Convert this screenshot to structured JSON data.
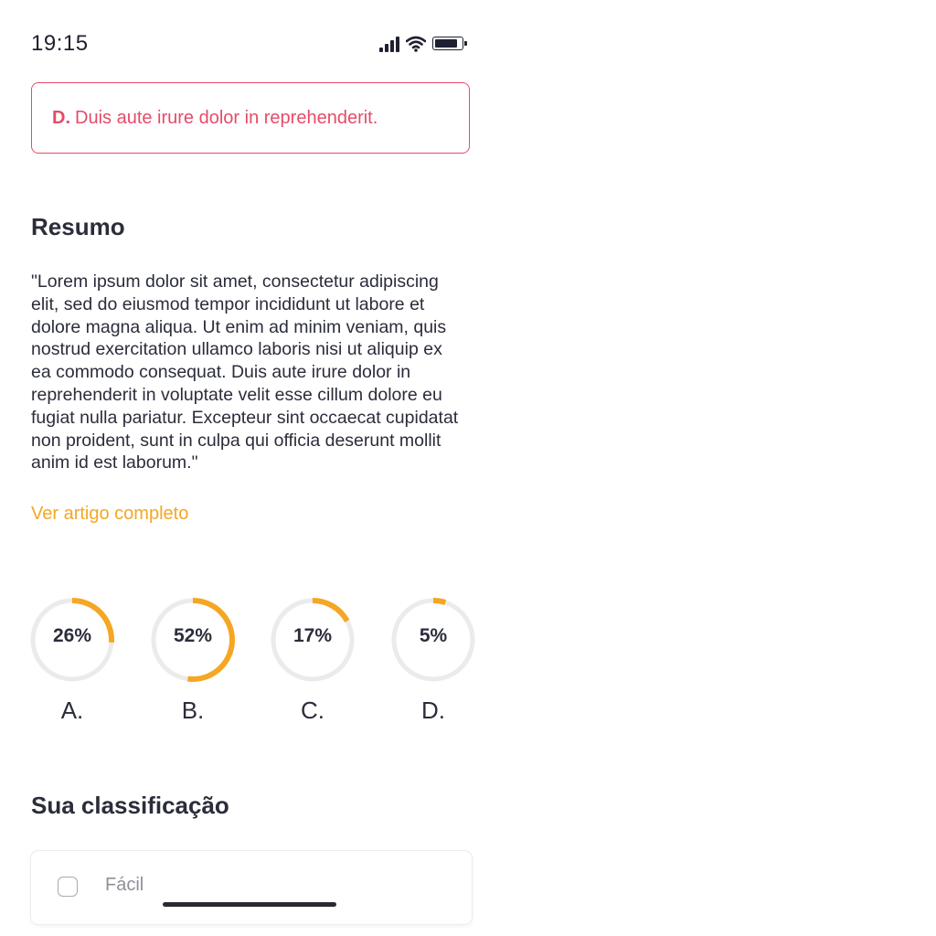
{
  "status_bar": {
    "time": "19:15",
    "battery_level": 0.9
  },
  "selected_answer": {
    "letter": "D.",
    "text": "Duis aute irure dolor in reprehenderit.",
    "color": "#e64b6a"
  },
  "summary": {
    "title": "Resumo",
    "text": "\"Lorem ipsum dolor sit amet, consectetur adipiscing elit, sed do eiusmod tempor incididunt ut labore et dolore magna aliqua. Ut enim ad minim veniam, quis nostrud exercitation ullamco laboris nisi ut aliquip ex ea commodo consequat. Duis aute irure dolor in reprehenderit in voluptate velit esse cillum dolore eu fugiat nulla pariatur. Excepteur sint occaecat cupidatat non proident, sunt in culpa qui officia deserunt mollit anim id est laborum.\"",
    "link_label": "Ver artigo completo"
  },
  "answer_stats": [
    {
      "label": "A.",
      "percent_text": "26%",
      "value": 26
    },
    {
      "label": "B.",
      "percent_text": "52%",
      "value": 52
    },
    {
      "label": "C.",
      "percent_text": "17%",
      "value": 17
    },
    {
      "label": "D.",
      "percent_text": "5%",
      "value": 5
    }
  ],
  "rating": {
    "title": "Sua classificação",
    "options": [
      {
        "label": "Fácil",
        "checked": false
      }
    ]
  },
  "colors": {
    "accent": "#f5a623",
    "track": "#ebebeb",
    "text": "#2b2d3b",
    "error": "#e64b6a"
  }
}
